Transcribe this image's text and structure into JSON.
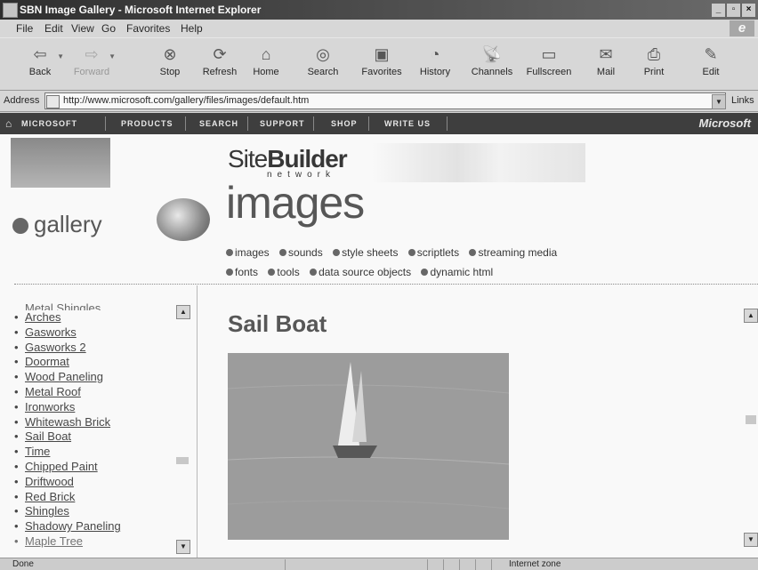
{
  "window": {
    "title": "SBN Image Gallery - Microsoft Internet Explorer",
    "controls": [
      "_",
      "▫",
      "×"
    ]
  },
  "menu": [
    "File",
    "Edit",
    "View",
    "Go",
    "Favorites",
    "Help"
  ],
  "toolbar": [
    {
      "label": "Back",
      "icon": "back-arrow-icon",
      "glyph": "⇦"
    },
    {
      "label": "Forward",
      "icon": "forward-arrow-icon",
      "glyph": "⇨",
      "disabled": true
    },
    {
      "label": "Stop",
      "icon": "stop-icon",
      "glyph": "⊗"
    },
    {
      "label": "Refresh",
      "icon": "refresh-icon",
      "glyph": "⟳"
    },
    {
      "label": "Home",
      "icon": "home-icon",
      "glyph": "⌂"
    },
    {
      "label": "Search",
      "icon": "search-icon",
      "glyph": "◎"
    },
    {
      "label": "Favorites",
      "icon": "favorites-icon",
      "glyph": "▣"
    },
    {
      "label": "History",
      "icon": "history-icon",
      "glyph": "◔"
    },
    {
      "label": "Channels",
      "icon": "channels-icon",
      "glyph": "📡"
    },
    {
      "label": "Fullscreen",
      "icon": "fullscreen-icon",
      "glyph": "▭"
    },
    {
      "label": "Mail",
      "icon": "mail-icon",
      "glyph": "✉"
    },
    {
      "label": "Print",
      "icon": "print-icon",
      "glyph": "⎙"
    },
    {
      "label": "Edit",
      "icon": "edit-icon",
      "glyph": "✎"
    }
  ],
  "address": {
    "label": "Address",
    "url": "http://www.microsoft.com/gallery/files/images/default.htm",
    "links_label": "Links"
  },
  "msnav": {
    "items": [
      "MICROSOFT",
      "PRODUCTS",
      "SEARCH",
      "SUPPORT",
      "SHOP",
      "WRITE US"
    ],
    "logo": "Microsoft"
  },
  "header": {
    "sitebuilder_prefix": "Site",
    "sitebuilder_bold": "Builder",
    "network": "network",
    "gallery": "gallery",
    "images": "images",
    "categories_row1": [
      "images",
      "sounds",
      "style sheets",
      "scriptlets",
      "streaming media"
    ],
    "categories_row2": [
      "fonts",
      "tools",
      "data source objects",
      "dynamic html"
    ]
  },
  "leftlist": {
    "partial_top": "Metal Shingles",
    "items": [
      "Arches",
      "Gasworks",
      "Gasworks 2",
      "Doormat",
      "Wood Paneling",
      "Metal Roof",
      "Ironworks",
      "Whitewash Brick",
      "Sail Boat",
      "Time",
      "Chipped Paint",
      "Driftwood",
      "Red Brick",
      "Shingles",
      "Shadowy Paneling"
    ],
    "partial_bottom": "Maple Tree"
  },
  "main": {
    "title": "Sail Boat"
  },
  "status": {
    "text": "Done",
    "zone": "Internet zone"
  }
}
